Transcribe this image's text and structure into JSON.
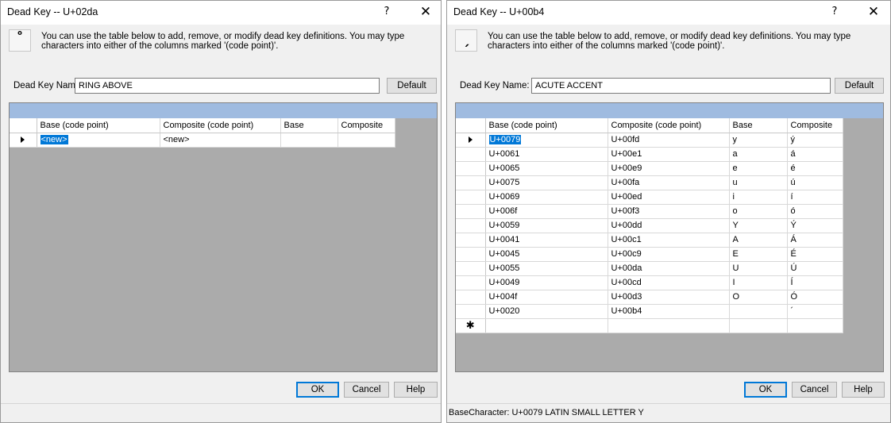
{
  "left": {
    "title": "Dead Key -- U+02da",
    "help_glyph": "?",
    "close_glyph": "✕",
    "glyph": "˚",
    "description": "You can use the table below to add, remove, or modify dead key definitions.  You may type characters into either of the columns marked '(code point)'.",
    "name_label": "Dead Key Name:",
    "name_value": "RING ABOVE",
    "default_label": "Default",
    "columns": [
      "Base  (code point)",
      "Composite (code point)",
      "Base",
      "Composite"
    ],
    "new_row": {
      "base_cp": "<new>",
      "composite_cp": "<new>"
    },
    "ok_label": "OK",
    "cancel_label": "Cancel",
    "help_label": "Help"
  },
  "right": {
    "title": "Dead Key -- U+00b4",
    "help_glyph": "?",
    "close_glyph": "✕",
    "glyph": "ˏ",
    "description": "You can use the table below to add, remove, or modify dead key definitions.  You may type characters into either of the columns marked '(code point)'.",
    "name_label": "Dead Key Name:",
    "name_value": "ACUTE ACCENT",
    "default_label": "Default",
    "columns": [
      "Base  (code point)",
      "Composite (code point)",
      "Base",
      "Composite"
    ],
    "rows": [
      {
        "base_cp": "U+0079",
        "composite_cp": "U+00fd",
        "base": "y",
        "composite": "ý"
      },
      {
        "base_cp": "U+0061",
        "composite_cp": "U+00e1",
        "base": "a",
        "composite": "á"
      },
      {
        "base_cp": "U+0065",
        "composite_cp": "U+00e9",
        "base": "e",
        "composite": "é"
      },
      {
        "base_cp": "U+0075",
        "composite_cp": "U+00fa",
        "base": "u",
        "composite": "ú"
      },
      {
        "base_cp": "U+0069",
        "composite_cp": "U+00ed",
        "base": "i",
        "composite": "í"
      },
      {
        "base_cp": "U+006f",
        "composite_cp": "U+00f3",
        "base": "o",
        "composite": "ó"
      },
      {
        "base_cp": "U+0059",
        "composite_cp": "U+00dd",
        "base": "Y",
        "composite": "Ý"
      },
      {
        "base_cp": "U+0041",
        "composite_cp": "U+00c1",
        "base": "A",
        "composite": "Á"
      },
      {
        "base_cp": "U+0045",
        "composite_cp": "U+00c9",
        "base": "E",
        "composite": "É"
      },
      {
        "base_cp": "U+0055",
        "composite_cp": "U+00da",
        "base": "U",
        "composite": "Ú"
      },
      {
        "base_cp": "U+0049",
        "composite_cp": "U+00cd",
        "base": "I",
        "composite": "Í"
      },
      {
        "base_cp": "U+004f",
        "composite_cp": "U+00d3",
        "base": "O",
        "composite": "Ó"
      },
      {
        "base_cp": "U+0020",
        "composite_cp": "U+00b4",
        "base": "",
        "composite": "´"
      }
    ],
    "ok_label": "OK",
    "cancel_label": "Cancel",
    "help_label": "Help",
    "status": "BaseCharacter: U+0079  LATIN SMALL LETTER Y"
  }
}
